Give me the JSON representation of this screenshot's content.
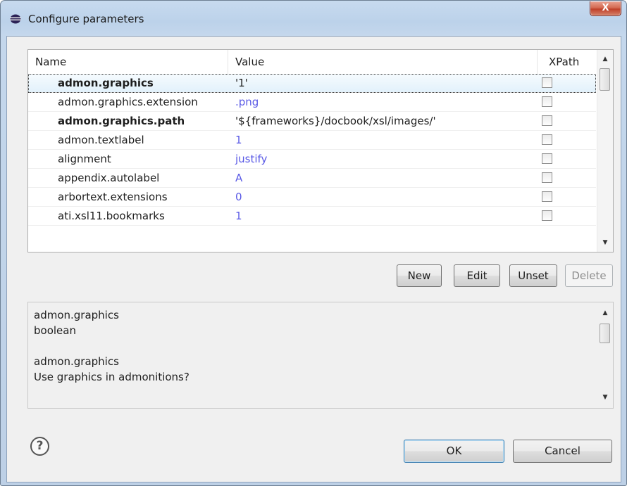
{
  "window": {
    "title": "Configure parameters",
    "close_label": "X"
  },
  "table": {
    "columns": {
      "name": "Name",
      "value": "Value",
      "xpath": "XPath"
    },
    "rows": [
      {
        "name": "admon.graphics",
        "value": "'1'",
        "bold": true,
        "value_is_default": false,
        "selected": true
      },
      {
        "name": "admon.graphics.extension",
        "value": ".png",
        "bold": false,
        "value_is_default": true,
        "selected": false
      },
      {
        "name": "admon.graphics.path",
        "value": "'${frameworks}/docbook/xsl/images/'",
        "bold": true,
        "value_is_default": false,
        "selected": false
      },
      {
        "name": "admon.textlabel",
        "value": "1",
        "bold": false,
        "value_is_default": true,
        "selected": false
      },
      {
        "name": "alignment",
        "value": "justify",
        "bold": false,
        "value_is_default": true,
        "selected": false
      },
      {
        "name": "appendix.autolabel",
        "value": "A",
        "bold": false,
        "value_is_default": true,
        "selected": false
      },
      {
        "name": "arbortext.extensions",
        "value": "0",
        "bold": false,
        "value_is_default": true,
        "selected": false
      },
      {
        "name": "ati.xsl11.bookmarks",
        "value": "1",
        "bold": false,
        "value_is_default": true,
        "selected": false
      }
    ]
  },
  "actions": {
    "new": "New",
    "edit": "Edit",
    "unset": "Unset",
    "delete": "Delete"
  },
  "description": {
    "line1": "admon.graphics",
    "line2": "boolean",
    "line3": "",
    "line4": "admon.graphics",
    "line5": "Use graphics in admonitions?"
  },
  "footer": {
    "help_symbol": "?",
    "ok": "OK",
    "cancel": "Cancel"
  },
  "colors": {
    "default_value": "#5a5ae6",
    "title_bar": "#bcd2ea",
    "close_button": "#c7503a"
  },
  "icons": {
    "title": "eclipse-icon",
    "help": "help-icon",
    "scroll_up": "scroll-up-arrow-icon",
    "scroll_down": "scroll-down-arrow-icon"
  }
}
